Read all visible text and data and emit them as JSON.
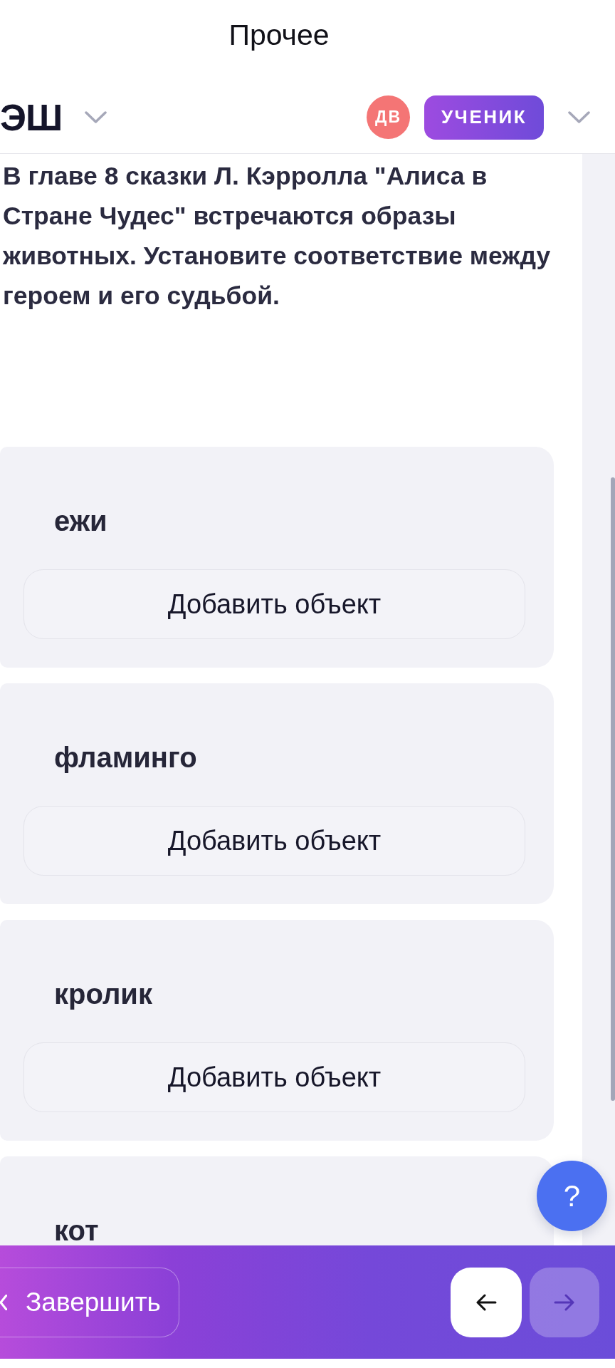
{
  "window": {
    "title": "Прочее"
  },
  "header": {
    "logo": "ЭШ",
    "avatar": {
      "initials": "ДВ"
    },
    "role_badge": "УЧЕНИК"
  },
  "question": {
    "text": "В главе 8 сказки Л. Кэрролла \"Алиса в Стране Чудес\" встречаются образы животных. Установите соответствие между героем и его судьбой."
  },
  "matches": [
    {
      "title": "ежи",
      "add_button": "Добавить объект"
    },
    {
      "title": "фламинго",
      "add_button": "Добавить объект"
    },
    {
      "title": "кролик",
      "add_button": "Добавить объект"
    },
    {
      "title": "кот"
    }
  ],
  "help_button": {
    "label": "?"
  },
  "footer": {
    "finish_button": "Завершить",
    "back_button": {
      "disabled": false
    },
    "next_button": {
      "disabled": true
    }
  }
}
